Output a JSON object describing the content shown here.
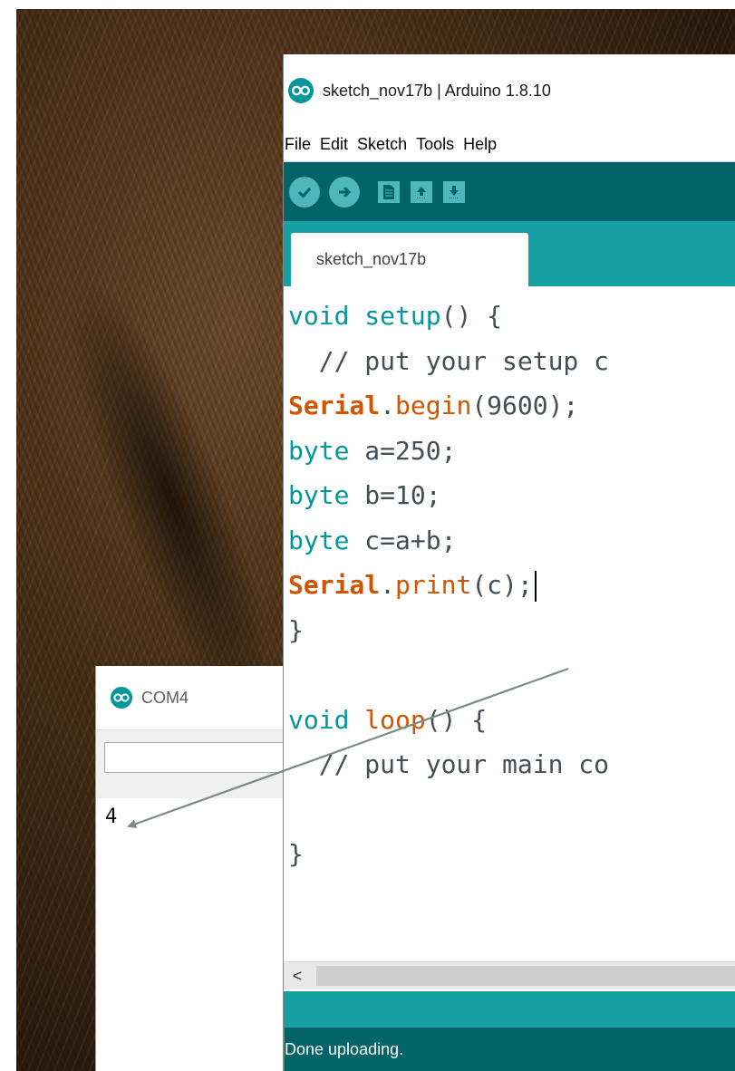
{
  "com_window": {
    "title": "COM4",
    "input_value": "",
    "output": "4"
  },
  "ide": {
    "title": "sketch_nov17b | Arduino 1.8.10",
    "menu": [
      "File",
      "Edit",
      "Sketch",
      "Tools",
      "Help"
    ],
    "toolbar": {
      "verify_icon": "check-icon",
      "upload_icon": "arrow-right-icon",
      "new_icon": "document-icon",
      "open_icon": "arrow-up-icon",
      "save_icon": "arrow-down-icon"
    },
    "tab_label": "sketch_nov17b",
    "code": {
      "l1_type": "void",
      "l1_rest": " setup",
      "l1_end": "() {",
      "l2": "  // put your setup c",
      "l3_obj": "Serial",
      "l3_dot": ".",
      "l3_fn": "begin",
      "l3_rest": "(9600);",
      "l4_type": "byte",
      "l4_rest": " a=250;",
      "l5_type": "byte",
      "l5_rest": " b=10;",
      "l6_type": "byte",
      "l6_rest": " c=a+b;",
      "l7_obj": "Serial",
      "l7_dot": ".",
      "l7_fn": "print",
      "l7_rest": "(c);",
      "l8": "}",
      "l9": "",
      "l10_type": "void",
      "l10_fn": " loop",
      "l10_rest": "() {",
      "l11": "  // put your main co",
      "l12": "",
      "l13": "}"
    },
    "scroll_left_glyph": "<",
    "status": "Done uploading."
  },
  "colors": {
    "toolbar_dark": "#006468",
    "accent_teal": "#17a1a5",
    "button_teal": "#4db7bb",
    "keyword_orange": "#d35400",
    "type_teal": "#00979c",
    "arrow_grey": "#7a8a84"
  }
}
